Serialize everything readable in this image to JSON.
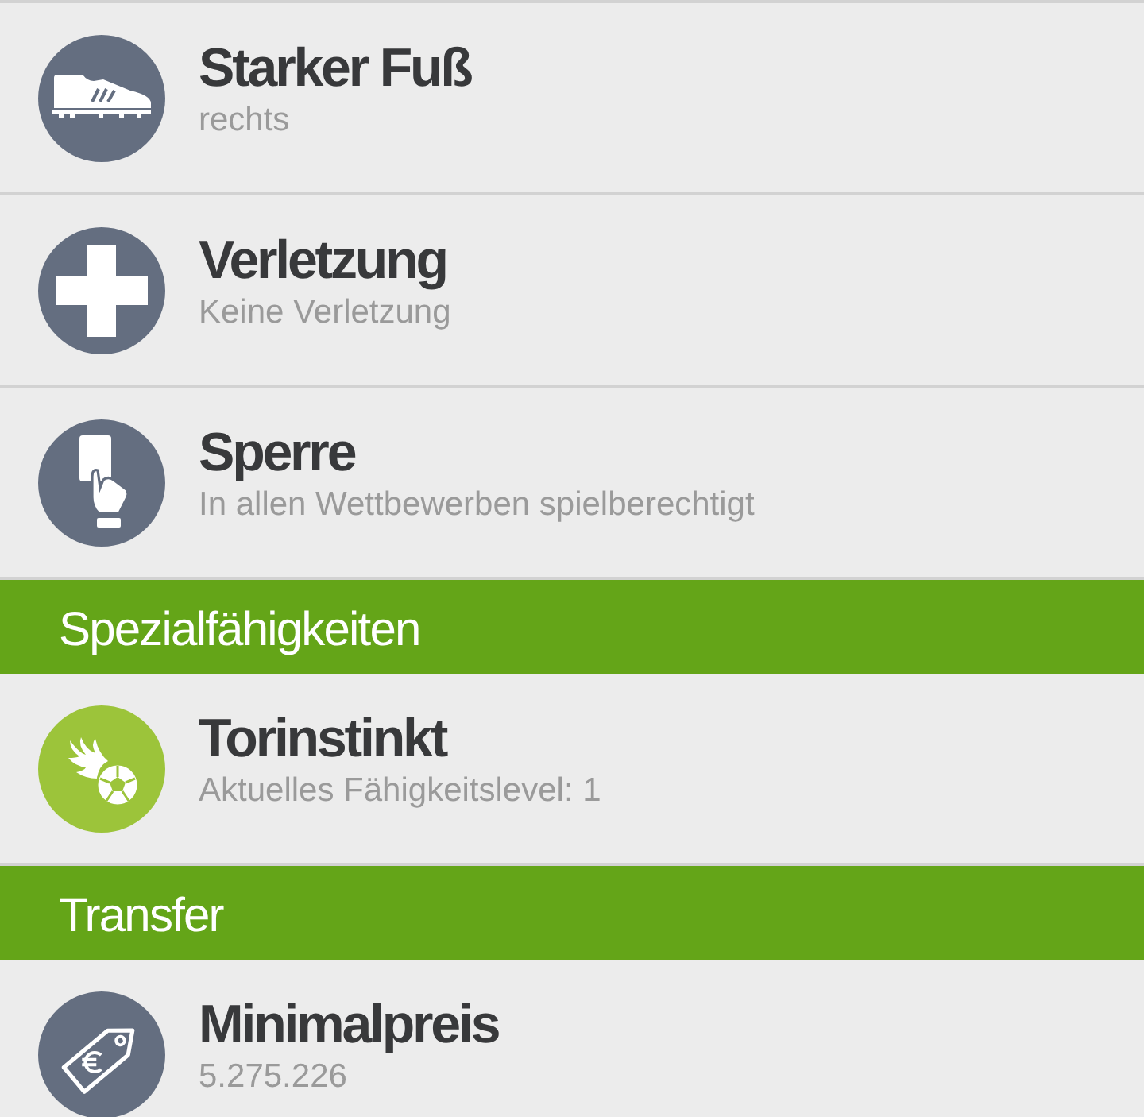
{
  "sections": [
    {
      "items": [
        {
          "kind": "boot",
          "color": "#646e80",
          "title": "Starker Fuß",
          "subtitle": "rechts"
        },
        {
          "kind": "plus",
          "color": "#646e80",
          "title": "Verletzung",
          "subtitle": "Keine Verletzung"
        },
        {
          "kind": "card",
          "color": "#646e80",
          "title": "Sperre",
          "subtitle": "In allen Wettbewerben spielberechtigt"
        }
      ]
    },
    {
      "header": "Spezialfähigkeiten",
      "items": [
        {
          "kind": "fireball",
          "color": "#9cc43a",
          "title": "Torinstinkt",
          "subtitle": "Aktuelles Fähigkeitslevel: 1"
        }
      ]
    },
    {
      "header": "Transfer",
      "items": [
        {
          "kind": "tag",
          "color": "#646e80",
          "title": "Minimalpreis",
          "subtitle": "5.275.226"
        }
      ]
    }
  ]
}
